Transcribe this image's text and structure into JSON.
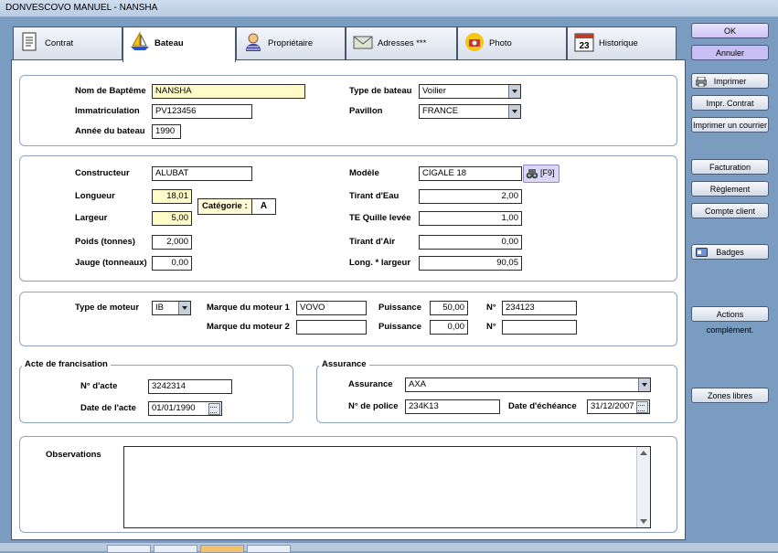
{
  "window": {
    "title": "DONVESCOVO MANUEL - NANSHA"
  },
  "tabs": [
    {
      "label": "Contrat",
      "icon": "document-icon"
    },
    {
      "label": "Bateau",
      "icon": "sailboat-icon"
    },
    {
      "label": "Propriétaire",
      "icon": "person-icon"
    },
    {
      "label": "Adresses ***",
      "icon": "envelope-icon"
    },
    {
      "label": "Photo",
      "icon": "camera-icon"
    },
    {
      "label": "Historique",
      "icon": "calendar-icon",
      "badge": "23"
    }
  ],
  "identity": {
    "nom_label": "Nom de Baptême",
    "nom": "NANSHA",
    "immat_label": "Immatriculation",
    "immat": "PV123456",
    "annee_label": "Année du bateau",
    "annee": "1990",
    "type_label": "Type de bateau",
    "type": "Voilier",
    "pavillon_label": "Pavillon",
    "pavillon": "FRANCE"
  },
  "specs": {
    "constructeur_label": "Constructeur",
    "constructeur": "ALUBAT",
    "longueur_label": "Longueur",
    "longueur": "18,01",
    "largeur_label": "Largeur",
    "largeur": "5,00",
    "poids_label": "Poids (tonnes)",
    "poids": "2,000",
    "jauge_label": "Jauge (tonneaux)",
    "jauge": "0,00",
    "categorie_label": "Catégorie :",
    "categorie": "A",
    "modele_label": "Modèle",
    "modele": "CIGALE 18",
    "f9_label": "[F9]",
    "tirant_eau_label": "Tirant d'Eau",
    "tirant_eau": "2,00",
    "te_quille_label": "TE Quille levée",
    "te_quille": "1,00",
    "tirant_air_label": "Tirant d'Air",
    "tirant_air": "0,00",
    "long_larg_label": "Long. * largeur",
    "long_larg": "90,05"
  },
  "moteur": {
    "type_label": "Type de moteur",
    "type": "IB",
    "marque1_label": "Marque du moteur 1",
    "marque1": "VOVO",
    "marque2_label": "Marque du moteur 2",
    "marque2": "",
    "puissance1_label": "Puissance",
    "puissance1": "50,00",
    "puissance2_label": "Puissance",
    "puissance2": "0,00",
    "n1_label": "N°",
    "n1": "234123",
    "n2_label": "N°",
    "n2": ""
  },
  "francisation": {
    "title": "Acte de francisation",
    "num_label": "N° d'acte",
    "num": "3242314",
    "date_label": "Date de l'acte",
    "date": "01/01/1990"
  },
  "assurance": {
    "title": "Assurance",
    "assur_label": "Assurance",
    "assur": "AXA",
    "police_label": "N° de police",
    "police": "234K13",
    "echeance_label": "Date d'échéance",
    "echeance": "31/12/2007"
  },
  "observations": {
    "label": "Observations",
    "value": ""
  },
  "actions": {
    "ok": "OK",
    "annuler": "Annuler",
    "imprimer": "Imprimer",
    "impr_contrat": "Impr. Contrat",
    "imprimer_courrier": "Imprimer un courrier",
    "facturation": "Facturation",
    "reglement": "Règlement",
    "compte_client": "Compte client",
    "badges": "Badges",
    "actions_compl": "Actions complément.",
    "zones_libres": "Zones libres"
  }
}
